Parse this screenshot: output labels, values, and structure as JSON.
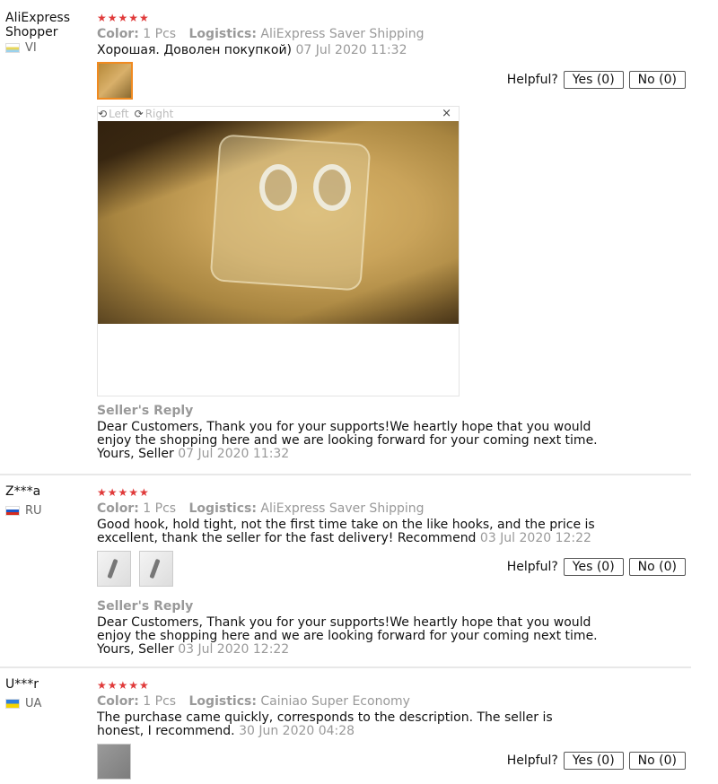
{
  "helpful_label": "Helpful?",
  "reply_title": "Seller's Reply",
  "reply_text": "Dear Customers, Thank you for your supports!We heartly hope that you would enjoy the shopping here and we are looking forward for your coming next time.",
  "reply_sign": "Yours, Seller",
  "meta_labels": {
    "color": "Color:",
    "logistics": "Logistics:"
  },
  "stars": "★★★★★",
  "viewer": {
    "left": "Left",
    "right": "Right",
    "close": "×"
  },
  "reviews": [
    {
      "user": "AliExpress Shopper",
      "country": "VI",
      "color": "1 Pcs",
      "logistics": "AliExpress Saver Shipping",
      "text": "Хорошая. Доволен покупкой)",
      "date": "07 Jul 2020 11:32",
      "yes": "Yes (0)",
      "no": "No (0)",
      "reply_date": "07 Jul 2020 11:32"
    },
    {
      "user": "Z***a",
      "country": "RU",
      "color": "1 Pcs",
      "logistics": "AliExpress Saver Shipping",
      "text": "Good hook, hold tight, not the first time take on the like hooks, and the price is excellent, thank the seller for the fast delivery! Recommend",
      "date": "03 Jul 2020 12:22",
      "yes": "Yes (0)",
      "no": "No (0)",
      "reply_date": "03 Jul 2020 12:22"
    },
    {
      "user": "U***r",
      "country": "UA",
      "color": "1 Pcs",
      "logistics": "Cainiao Super Economy",
      "text": "The purchase came quickly, corresponds to the description. The seller is honest, I recommend.",
      "date": "30 Jun 2020 04:28",
      "yes": "Yes (0)",
      "no": "No (0)"
    }
  ]
}
